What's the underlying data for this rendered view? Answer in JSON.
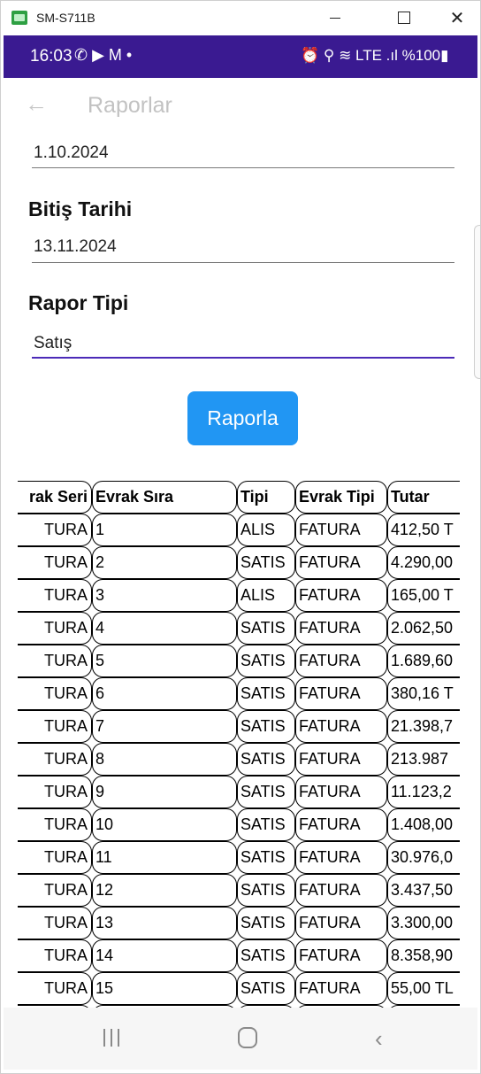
{
  "window": {
    "title": "SM-S711B",
    "minimize": "—",
    "maximize": "☐",
    "close": "✕"
  },
  "status_bar": {
    "time": "16:03",
    "left_icons": "✆ ▶ M •",
    "right": "⏰ ⚲ ≋ LTE .ıl %100▮",
    "color": "#3a1a91"
  },
  "app_bar": {
    "back": "←",
    "title": "Raporlar"
  },
  "form": {
    "start_date": "1.10.2024",
    "end_label": "Bitiş Tarihi",
    "end_date": "13.11.2024",
    "type_label": "Rapor Tipi",
    "type_value": "Satış"
  },
  "report_button": {
    "label": "Raporla",
    "color": "#2196f3"
  },
  "table": {
    "headers": [
      "rak Seri",
      "Evrak Sıra",
      "Tipi",
      "Evrak Tipi",
      "Tutar"
    ],
    "rows": [
      [
        "TURA",
        "1",
        "ALIS",
        "FATURA",
        "412,50 T"
      ],
      [
        "TURA",
        "2",
        "SATIS",
        "FATURA",
        "4.290,00"
      ],
      [
        "TURA",
        "3",
        "ALIS",
        "FATURA",
        "165,00 T"
      ],
      [
        "TURA",
        "4",
        "SATIS",
        "FATURA",
        "2.062,50"
      ],
      [
        "TURA",
        "5",
        "SATIS",
        "FATURA",
        "1.689,60"
      ],
      [
        "TURA",
        "6",
        "SATIS",
        "FATURA",
        "380,16 T"
      ],
      [
        "TURA",
        "7",
        "SATIS",
        "FATURA",
        "21.398,7"
      ],
      [
        "TURA",
        "8",
        "SATIS",
        "FATURA",
        "213.987"
      ],
      [
        "TURA",
        "9",
        "SATIS",
        "FATURA",
        "11.123,2"
      ],
      [
        "TURA",
        "10",
        "SATIS",
        "FATURA",
        "1.408,00"
      ],
      [
        "TURA",
        "11",
        "SATIS",
        "FATURA",
        "30.976,0"
      ],
      [
        "TURA",
        "12",
        "SATIS",
        "FATURA",
        "3.437,50"
      ],
      [
        "TURA",
        "13",
        "SATIS",
        "FATURA",
        "3.300,00"
      ],
      [
        "TURA",
        "14",
        "SATIS",
        "FATURA",
        "8.358,90"
      ],
      [
        "TURA",
        "15",
        "SATIS",
        "FATURA",
        "55,00 TL"
      ],
      [
        "",
        "",
        "",
        "",
        ""
      ]
    ]
  },
  "nav_bar": {
    "recents": "recents-icon",
    "home": "home-icon",
    "back": "‹"
  }
}
